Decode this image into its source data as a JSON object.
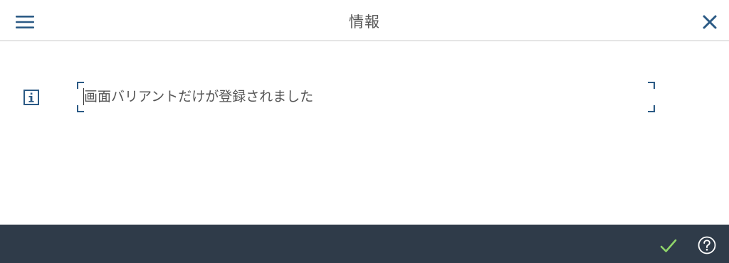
{
  "dialog": {
    "title": "情報",
    "message": "画面バリアントだけが登録されました",
    "message_type": "info"
  },
  "header": {
    "menu_icon": "menu-icon",
    "close_icon": "close-icon"
  },
  "footer": {
    "ok_icon": "checkmark-icon",
    "help_icon": "help-icon"
  },
  "colors": {
    "accent": "#2b5a85",
    "footer_background": "#2f3b49",
    "checkmark": "#8fd46a",
    "text": "#555555"
  }
}
